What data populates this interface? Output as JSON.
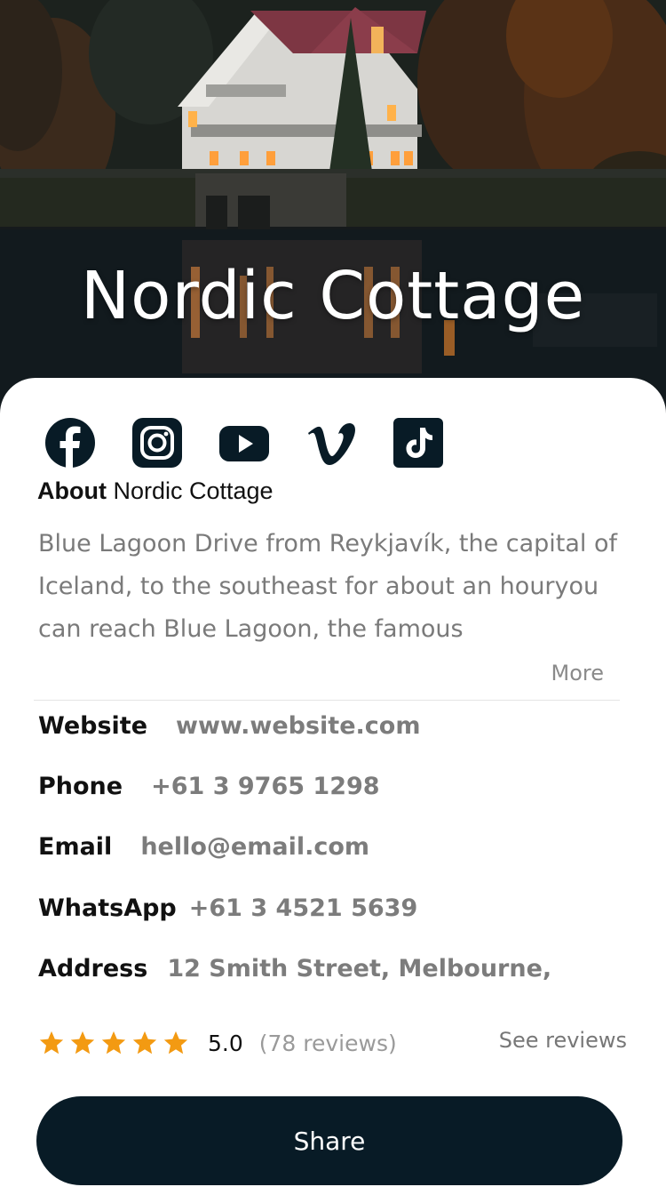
{
  "hero": {
    "title": "Nordic Cottage"
  },
  "socials": [
    {
      "name": "facebook-icon"
    },
    {
      "name": "instagram-icon"
    },
    {
      "name": "youtube-icon"
    },
    {
      "name": "vimeo-icon"
    },
    {
      "name": "tiktok-icon"
    }
  ],
  "about": {
    "heading_bold": "About",
    "heading_rest": " Nordic Cottage",
    "text": "Blue Lagoon Drive from Reykjavík, the capital of Iceland, to the southeast for about an houryou can reach Blue Lagoon, the famous",
    "more_label": "More"
  },
  "info": {
    "website": {
      "label": "Website",
      "value": "www.website.com"
    },
    "phone": {
      "label": "Phone",
      "value": "+61 3 9765 1298"
    },
    "email": {
      "label": "Email",
      "value": "hello@email.com"
    },
    "whatsapp": {
      "label": "WhatsApp",
      "value": "+61 3 4521 5639"
    },
    "address": {
      "label": "Address",
      "value": "12 Smith Street, Melbourne,"
    }
  },
  "rating": {
    "stars": 5,
    "value": "5.0",
    "count": "(78 reviews)",
    "see_reviews_label": "See reviews"
  },
  "share": {
    "label": "Share"
  },
  "colors": {
    "primary_dark": "#081b26",
    "star": "#f39a12",
    "muted_text": "#7a7a7a"
  }
}
